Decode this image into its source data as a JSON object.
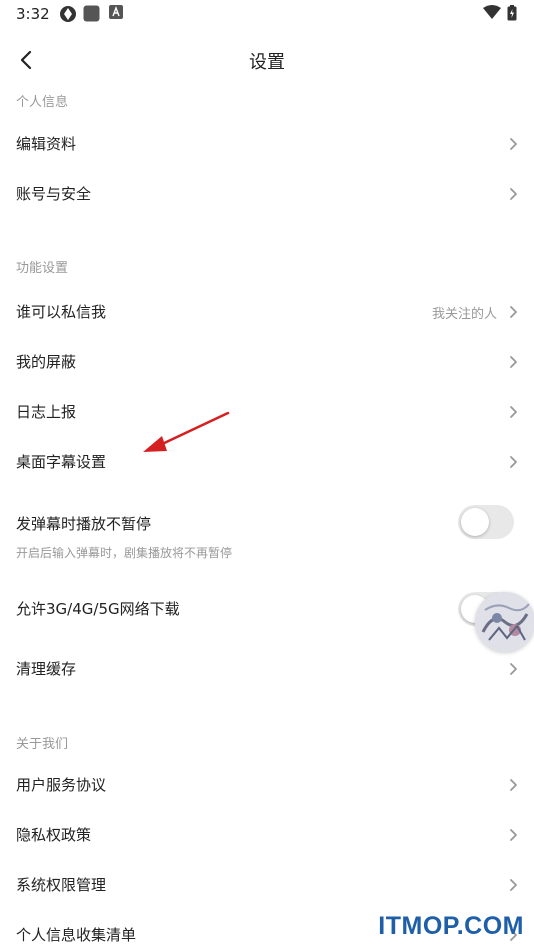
{
  "status_bar": {
    "time": "3:32",
    "icons": [
      "settings-app-icon",
      "square-app-icon",
      "a-app-icon",
      "wifi-icon",
      "battery-charging-icon"
    ]
  },
  "header": {
    "title": "设置",
    "back_icon": "chevron-left-icon"
  },
  "sections": {
    "personal": {
      "title": "个人信息",
      "items": [
        {
          "label": "编辑资料"
        },
        {
          "label": "账号与安全"
        }
      ]
    },
    "function": {
      "title": "功能设置",
      "items": [
        {
          "label": "谁可以私信我",
          "value": "我关注的人"
        },
        {
          "label": "我的屏蔽"
        },
        {
          "label": "日志上报"
        },
        {
          "label": "桌面字幕设置"
        }
      ],
      "danmaku_toggle": {
        "label": "发弹幕时播放不暂停",
        "hint": "开启后输入弹幕时，剧集播放将不再暂停",
        "on": false
      },
      "network_toggle": {
        "label": "允许3G/4G/5G网络下载",
        "on": false
      },
      "clear_cache": {
        "label": "清理缓存"
      }
    },
    "about": {
      "title": "关于我们",
      "items": [
        {
          "label": "用户服务协议"
        },
        {
          "label": "隐私权政策"
        },
        {
          "label": "系统权限管理"
        },
        {
          "label": "个人信息收集清单"
        }
      ]
    }
  },
  "colors": {
    "annotation_arrow": "#d42020",
    "watermark": "#1f5fa8",
    "toggle_off": "#e8e8e8"
  },
  "watermark": "ITMOP.COM"
}
